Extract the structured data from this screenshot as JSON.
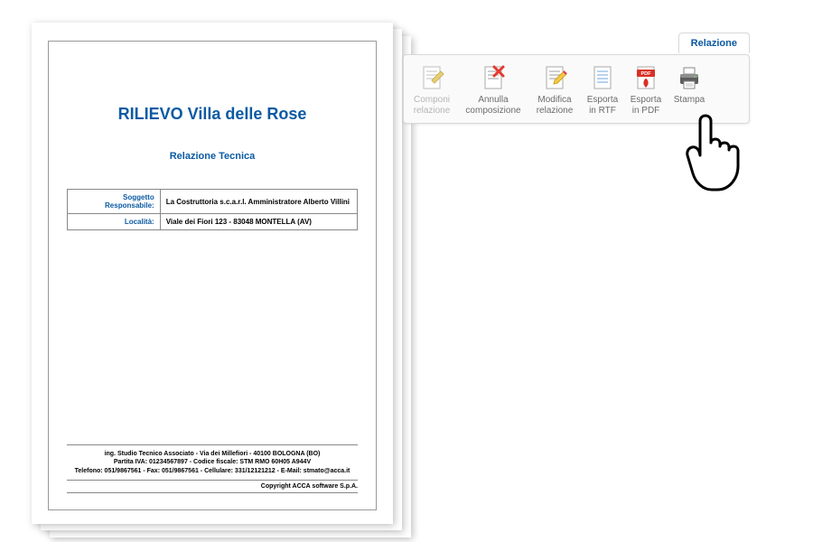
{
  "document": {
    "title": "RILIEVO Villa delle Rose",
    "subtitle": "Relazione Tecnica",
    "fields": {
      "responsabile_label": "Soggetto Responsabile:",
      "responsabile_value": "La Costruttoria s.c.a.r.l. Amministratore Alberto Villini",
      "localita_label": "Località:",
      "localita_value": "Viale dei Fiori 123 - 83048 MONTELLA (AV)"
    },
    "footer": {
      "line1": "ing. Studio Tecnico Associato - Via dei Millefiori - 40100 BOLOGNA (BO)",
      "line2": "Partita IVA: 01234567897 - Codice fiscale: STM RMO 60H05 A944V",
      "line3": "Telefono: 051/9867561 - Fax: 051/9867561 - Cellulare: 331/12121212 - E-Mail: stmato@acca.it",
      "copyright": "Copyright ACCA software S.p.A."
    }
  },
  "ribbon": {
    "tab": "Relazione",
    "items": [
      {
        "label": "Componi\nrelazione"
      },
      {
        "label": "Annulla\ncomposizione"
      },
      {
        "label": "Modifica\nrelazione"
      },
      {
        "label": "Esporta\nin RTF"
      },
      {
        "label": "Esporta\nin PDF"
      },
      {
        "label": "Stampa"
      }
    ]
  }
}
